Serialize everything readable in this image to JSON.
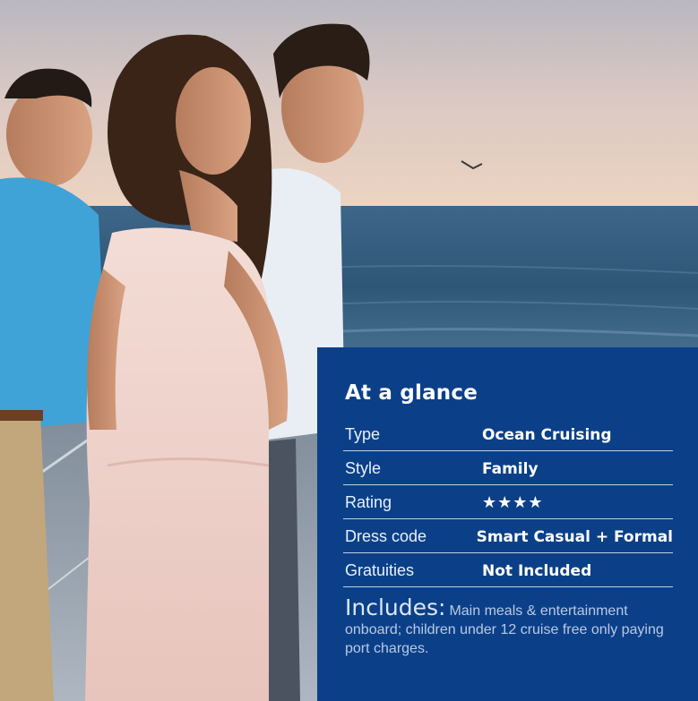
{
  "glance": {
    "title": "At a glance",
    "rows": [
      {
        "label": "Type",
        "value": "Ocean Cruising"
      },
      {
        "label": "Style",
        "value": "Family"
      },
      {
        "label": "Rating",
        "value": "★★★★"
      },
      {
        "label": "Dress code",
        "value": "Smart Casual + Formal"
      },
      {
        "label": "Gratuities",
        "value": "Not Included"
      }
    ],
    "includes_label": "Includes:",
    "includes_text": "Main meals & entertainment onboard; children under 12 cruise free only paying port charges."
  },
  "colors": {
    "panel_bg": "#0b4089",
    "sky": "#e7cfc0",
    "sea": "#2f5b7f"
  }
}
